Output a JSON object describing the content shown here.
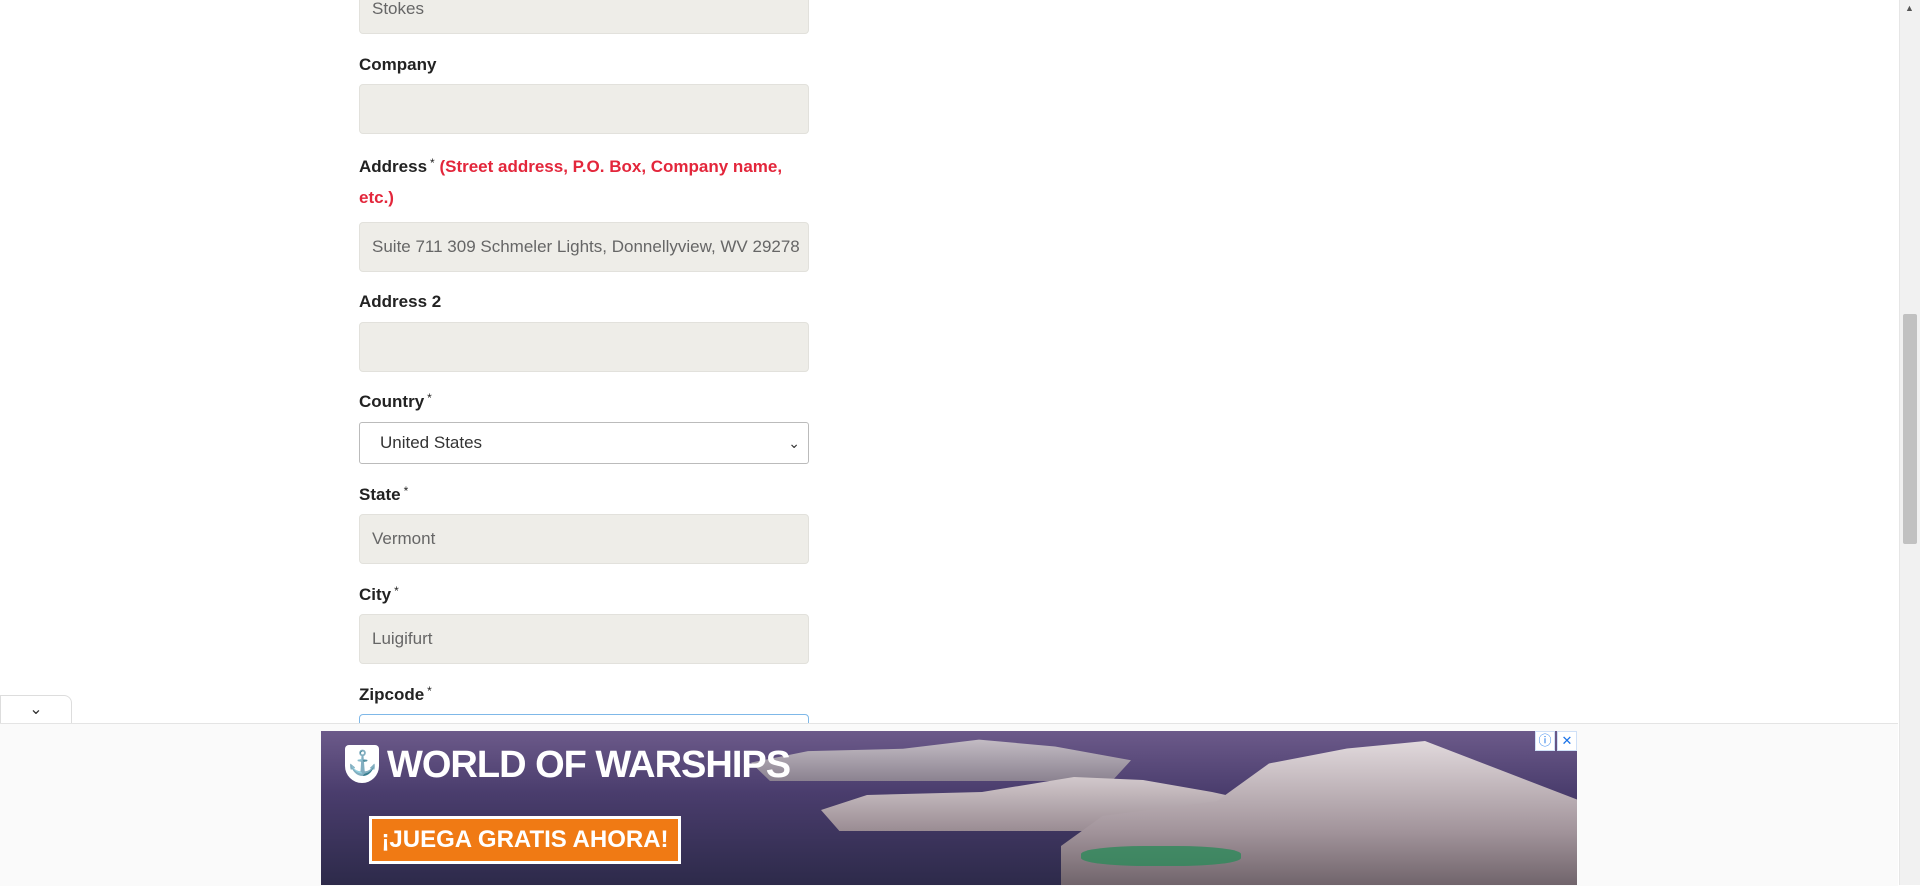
{
  "form": {
    "last_name_value": "Stokes",
    "company": {
      "label": "Company",
      "value": ""
    },
    "address": {
      "label": "Address",
      "required_mark": "*",
      "hint_line1": "(Street address, P.O. Box, Company name,",
      "hint_line2": "etc.)",
      "value": "Suite 711 309 Schmeler Lights, Donnellyview, WV 29278"
    },
    "address2": {
      "label": "Address 2",
      "value": ""
    },
    "country": {
      "label": "Country",
      "required_mark": "*",
      "selected": "United States"
    },
    "state": {
      "label": "State",
      "required_mark": "*",
      "value": "Vermont"
    },
    "city": {
      "label": "City",
      "required_mark": "*",
      "value": "Luigifurt"
    },
    "zipcode": {
      "label": "Zipcode",
      "required_mark": "*",
      "value": ""
    }
  },
  "ad": {
    "brand": "WORLD OF WARSHIPS",
    "cta": "¡JUEGA GRATIS AHORA!",
    "info_icon": "info-icon",
    "close_icon": "close-icon",
    "collapse_icon": "chevron-down-icon"
  },
  "colors": {
    "hint_red": "#e3263b",
    "field_bg": "#eeede8",
    "cta_orange": "#f07a14"
  }
}
